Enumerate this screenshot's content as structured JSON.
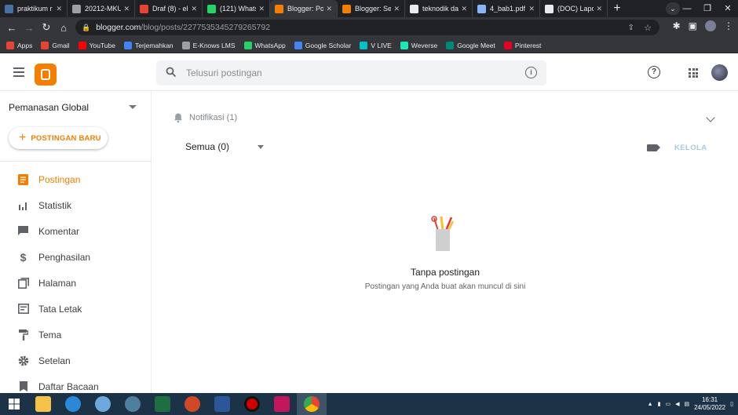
{
  "browser": {
    "tabs": [
      {
        "title": "praktikum r",
        "favicon_color": "#4a6fa5",
        "active": false
      },
      {
        "title": "20212-MKU",
        "favicon_color": "#9aa0a6",
        "active": false
      },
      {
        "title": "Draf (8) - el",
        "favicon_color": "#ea4335",
        "active": false
      },
      {
        "title": "(121) Whats",
        "favicon_color": "#25d366",
        "active": false
      },
      {
        "title": "Blogger: Po",
        "favicon_color": "#f57d00",
        "active": true
      },
      {
        "title": "Blogger: Se",
        "favicon_color": "#f57d00",
        "active": false
      },
      {
        "title": "teknodik da",
        "favicon_color": "#e8eaed",
        "active": false
      },
      {
        "title": "4_bab1.pdf",
        "favicon_color": "#8ab4f8",
        "active": false
      },
      {
        "title": "(DOC) Lapo",
        "favicon_color": "#e8eaed",
        "active": false
      }
    ],
    "new_tab": "+",
    "url_host": "blogger.com",
    "url_path": "/blog/posts/2277535345279265792",
    "bookmarks": [
      {
        "label": "Apps",
        "color": "#ea4335"
      },
      {
        "label": "Gmail",
        "color": "#ea4335"
      },
      {
        "label": "YouTube",
        "color": "#ff0000"
      },
      {
        "label": "Terjemahkan",
        "color": "#4285f4"
      },
      {
        "label": "E-Knows LMS",
        "color": "#9aa0a6"
      },
      {
        "label": "WhatsApp",
        "color": "#25d366"
      },
      {
        "label": "Google Scholar",
        "color": "#4285f4"
      },
      {
        "label": "V LIVE",
        "color": "#00c3c8"
      },
      {
        "label": "Weverse",
        "color": "#1de9b6"
      },
      {
        "label": "Google Meet",
        "color": "#00897b"
      },
      {
        "label": "Pinterest",
        "color": "#e60023"
      }
    ]
  },
  "header": {
    "search_placeholder": "Telusuri postingan",
    "accent_color": "#f57d00"
  },
  "sidebar": {
    "blog_name": "Pemanasan Global",
    "new_post_label": "POSTINGAN BARU",
    "items": [
      {
        "label": "Postingan",
        "icon": "posts-icon",
        "active": true
      },
      {
        "label": "Statistik",
        "icon": "stats-icon",
        "active": false
      },
      {
        "label": "Komentar",
        "icon": "comment-icon",
        "active": false
      },
      {
        "label": "Penghasilan",
        "icon": "dollar-icon",
        "active": false
      },
      {
        "label": "Halaman",
        "icon": "pages-icon",
        "active": false
      },
      {
        "label": "Tata Letak",
        "icon": "layout-icon",
        "active": false
      },
      {
        "label": "Tema",
        "icon": "paint-roller-icon",
        "active": false
      },
      {
        "label": "Setelan",
        "icon": "gear-icon",
        "active": false
      },
      {
        "label": "Daftar Bacaan",
        "icon": "bookmark-icon",
        "active": false
      }
    ]
  },
  "main": {
    "notification_label": "Notifikasi (1)",
    "filter_label": "Semua (0)",
    "manage_label": "KELOLA",
    "empty_title": "Tanpa postingan",
    "empty_subtitle": "Postingan yang Anda buat akan muncul di sini"
  },
  "taskbar": {
    "time": "16:31",
    "date": "24/05/2022"
  }
}
